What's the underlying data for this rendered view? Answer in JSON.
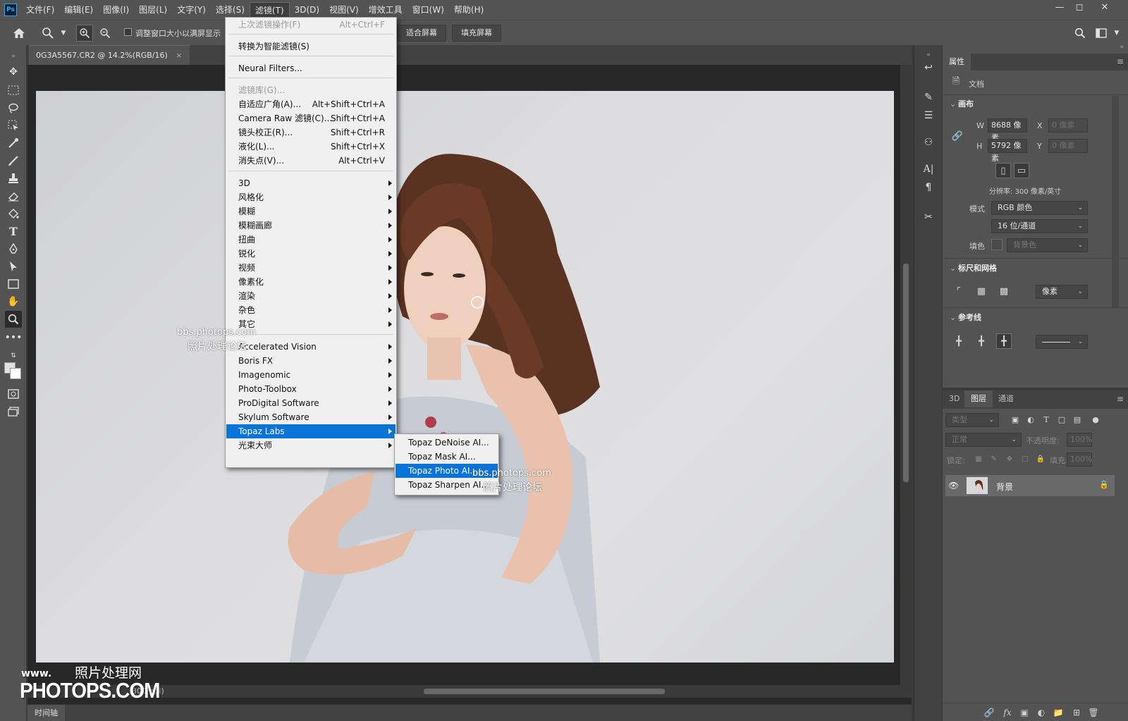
{
  "app": {
    "logo": "Ps"
  },
  "menubar": {
    "items": [
      "文件(F)",
      "编辑(E)",
      "图像(I)",
      "图层(L)",
      "文字(Y)",
      "选择(S)",
      "滤镜(T)",
      "3D(D)",
      "视图(V)",
      "增效工具",
      "窗口(W)",
      "帮助(H)"
    ],
    "active_index": 6
  },
  "options": {
    "resize_label": "调整窗口大小以满屏显示",
    "fit_screen": "适合屏幕",
    "fill_screen": "填充屏幕"
  },
  "document": {
    "tab_title": "0G3A5567.CR2 @ 14.2%(RGB/16)",
    "status_text": "300 ppi)"
  },
  "filter_menu": {
    "items": [
      {
        "label": "上次滤镜操作(F)",
        "shortcut": "Alt+Ctrl+F",
        "disabled": true
      },
      {
        "label": "转换为智能滤镜(S)",
        "shortcut": ""
      },
      {
        "label": "Neural Filters...",
        "shortcut": ""
      },
      {
        "label": "滤镜库(G)...",
        "shortcut": "",
        "disabled": true
      },
      {
        "label": "自适应广角(A)...",
        "shortcut": "Alt+Shift+Ctrl+A"
      },
      {
        "label": "Camera Raw 滤镜(C)...",
        "shortcut": "Shift+Ctrl+A"
      },
      {
        "label": "镜头校正(R)...",
        "shortcut": "Shift+Ctrl+R"
      },
      {
        "label": "液化(L)...",
        "shortcut": "Shift+Ctrl+X"
      },
      {
        "label": "消失点(V)...",
        "shortcut": "Alt+Ctrl+V"
      },
      {
        "label": "3D"
      },
      {
        "label": "风格化"
      },
      {
        "label": "模糊"
      },
      {
        "label": "模糊画廊"
      },
      {
        "label": "扭曲"
      },
      {
        "label": "锐化"
      },
      {
        "label": "视频"
      },
      {
        "label": "像素化"
      },
      {
        "label": "渲染"
      },
      {
        "label": "杂色"
      },
      {
        "label": "其它"
      },
      {
        "label": "Accelerated Vision"
      },
      {
        "label": "Boris FX"
      },
      {
        "label": "Imagenomic"
      },
      {
        "label": "Photo-Toolbox"
      },
      {
        "label": "ProDigital Software"
      },
      {
        "label": "Skylum Software"
      },
      {
        "label": "Topaz Labs",
        "selected": true
      },
      {
        "label": "光束大师"
      }
    ]
  },
  "topaz_submenu": {
    "items": [
      {
        "label": "Topaz DeNoise AI..."
      },
      {
        "label": "Topaz Mask AI..."
      },
      {
        "label": "Topaz Photo AI...",
        "selected": true
      },
      {
        "label": "Topaz Sharpen AI..."
      }
    ]
  },
  "properties": {
    "tab": "属性",
    "doc_label": "文档",
    "canvas_title": "画布",
    "w_label": "W",
    "w_value": "8688 像素",
    "h_label": "H",
    "h_value": "5792 像素",
    "x_label": "X",
    "x_placeholder": "0 像素",
    "y_label": "Y",
    "y_placeholder": "0 像素",
    "resolution": "分辨率: 300 像素/英寸",
    "mode_label": "模式",
    "mode_value": "RGB 颜色",
    "depth_value": "16 位/通道",
    "fill_label": "填色",
    "fill_value": "背景色",
    "rulers_title": "标尺和网格",
    "units_value": "像素",
    "guides_title": "参考线"
  },
  "layers_panel": {
    "tabs": [
      "3D",
      "图层",
      "通道"
    ],
    "active_tab": 1,
    "filter_kind": "类型",
    "blend_mode": "正常",
    "opacity_label": "不透明度:",
    "opacity_value": "100%",
    "lock_label": "锁定:",
    "fill_label": "填充:",
    "fill_value": "100%",
    "layer_name": "背景"
  },
  "timeline": {
    "label": "时间轴"
  },
  "watermarks": {
    "bbs": "bbs.photops.com",
    "forum": "照片处理论坛",
    "www": "www.",
    "cn": "照片处理网",
    "brand": "PHOTOPS.COM"
  },
  "colors": {
    "menu_highlight": "#0b74d8",
    "panel_bg": "#535353",
    "canvas_bg": "#282828"
  }
}
